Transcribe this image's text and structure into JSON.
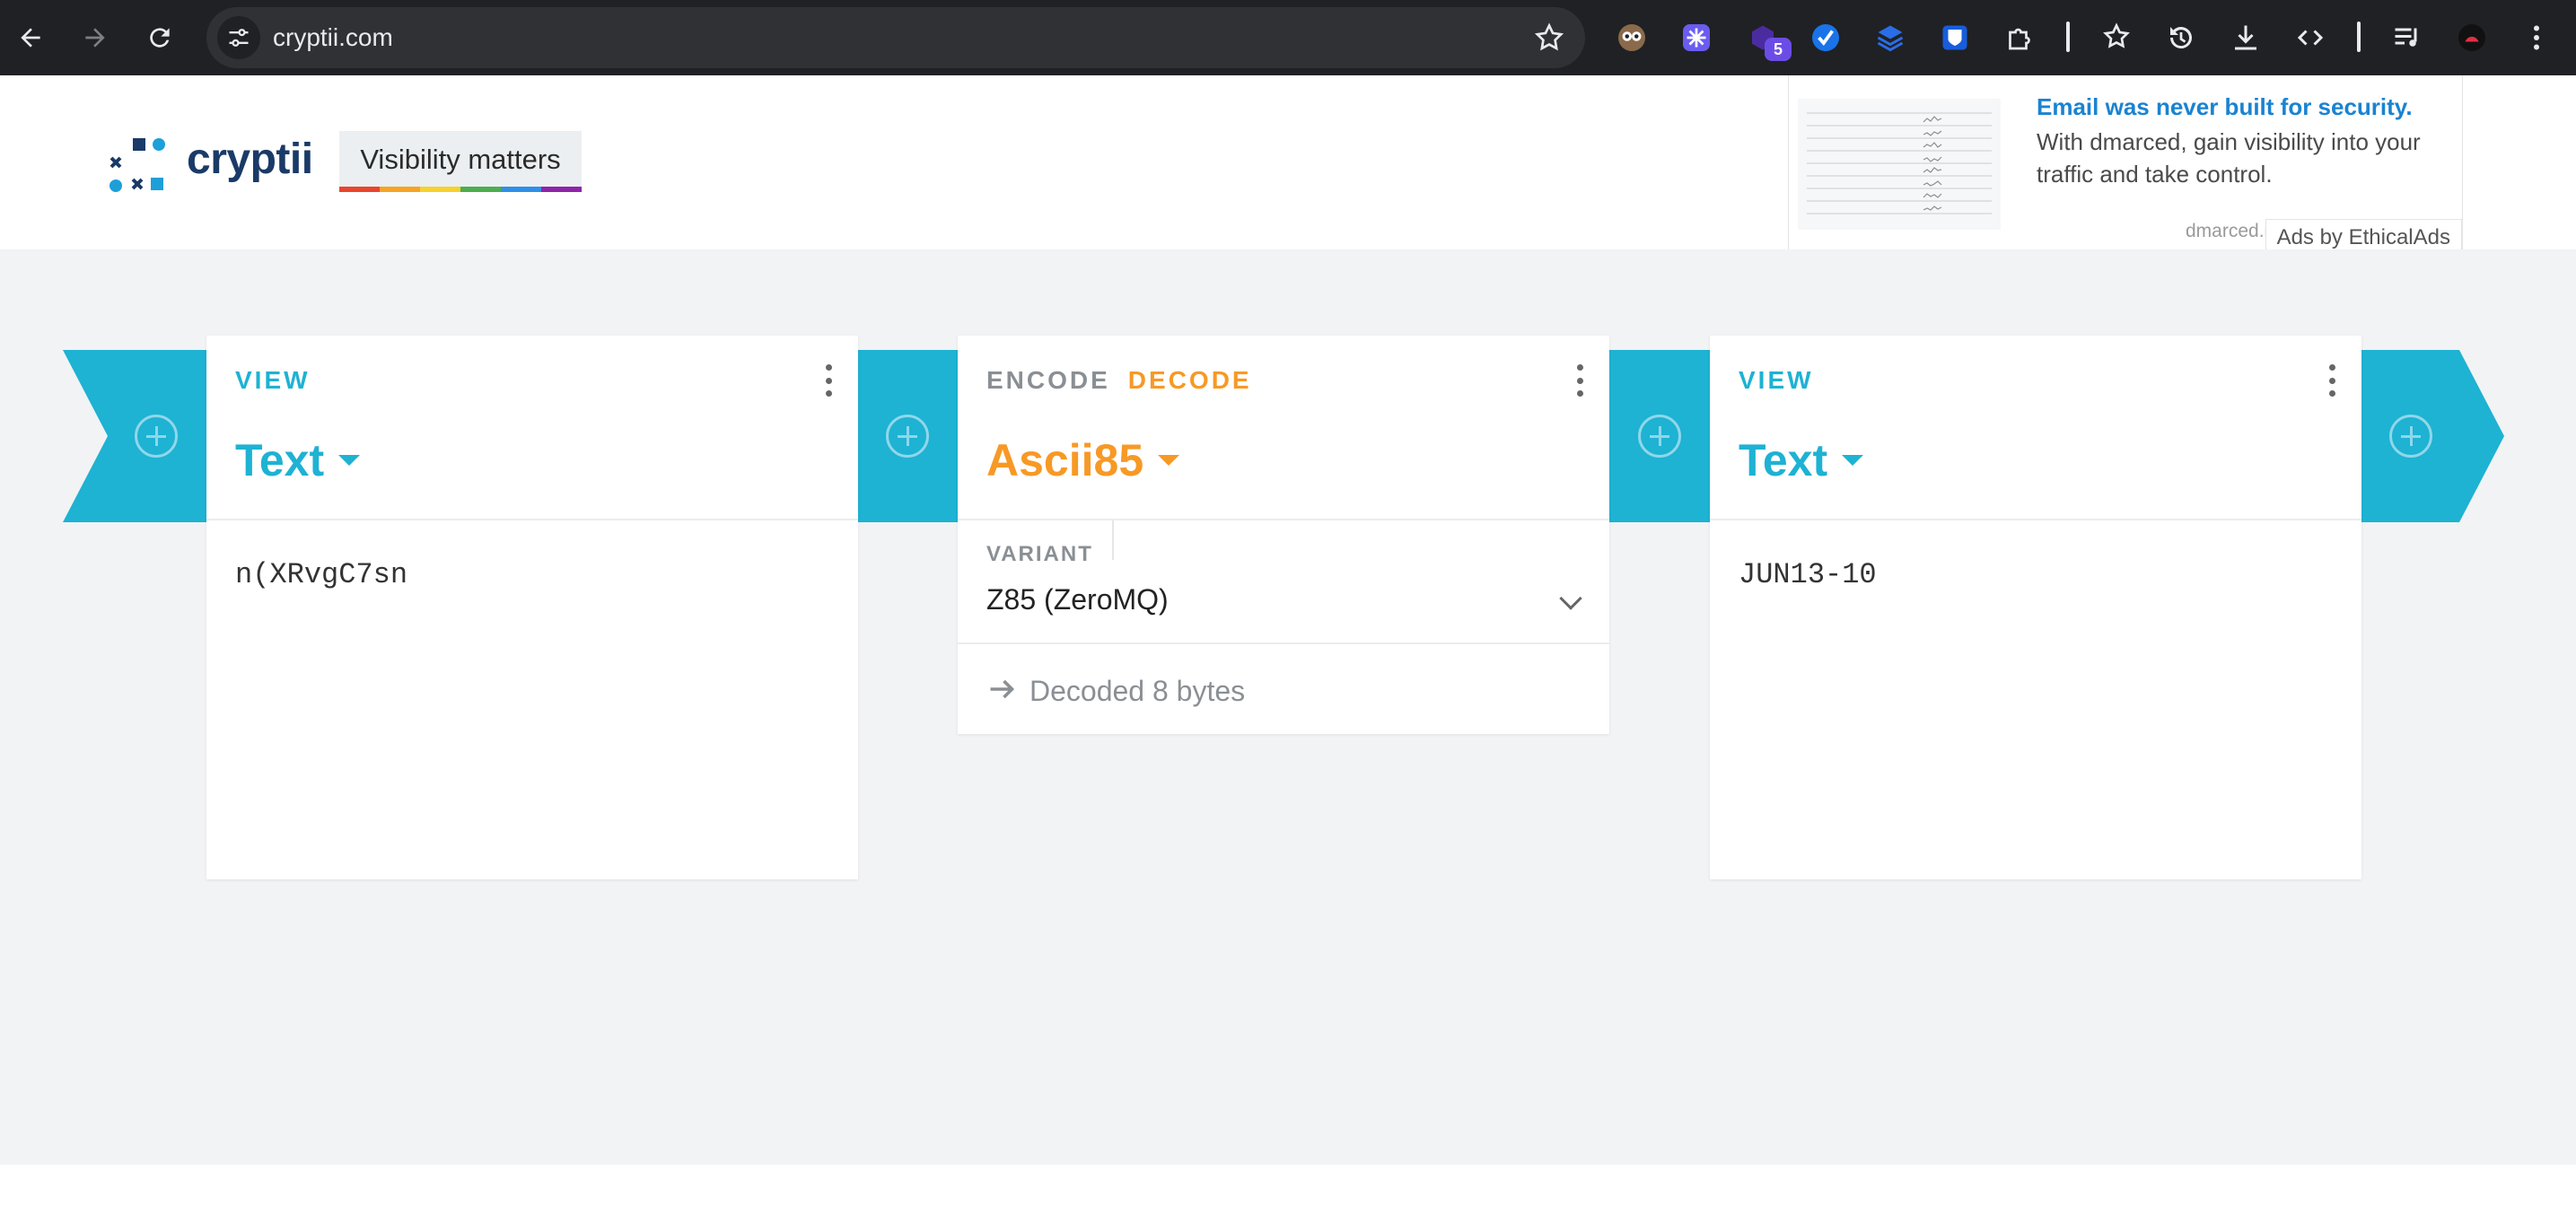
{
  "browser": {
    "url": "cryptii.com",
    "extension_badge": "5"
  },
  "header": {
    "brand": "cryptii",
    "tagline": "Visibility matters",
    "rainbow_colors": [
      "#e8452c",
      "#f7a325",
      "#f7d12c",
      "#4bae4f",
      "#2f8fe8",
      "#8e24aa"
    ]
  },
  "ad": {
    "title": "Email was never built for security.",
    "body": "With dmarced, gain visibility into your traffic and take control.",
    "domain": "dmarced.io",
    "attribution": "Ads by EthicalAds"
  },
  "colors": {
    "ribbon": "#1eb2d3",
    "view_accent": "#1eb2d3",
    "encoder_accent": "#f79925"
  },
  "bricks": [
    {
      "kind": "VIEW",
      "title": "Text",
      "content": "n(XRvgC7sn"
    },
    {
      "kind_encode": "ENCODE",
      "kind_decode": "DECODE",
      "title": "Ascii85",
      "setting_label": "VARIANT",
      "setting_value": "Z85 (ZeroMQ)",
      "status": "Decoded 8 bytes"
    },
    {
      "kind": "VIEW",
      "title": "Text",
      "content": "JUN13-10"
    }
  ],
  "icons": [
    "back-icon",
    "forward-icon",
    "reload-icon",
    "site-info-icon",
    "star-icon",
    "add-icon",
    "more-icon",
    "chevron-down-icon",
    "arrow-right-icon"
  ]
}
